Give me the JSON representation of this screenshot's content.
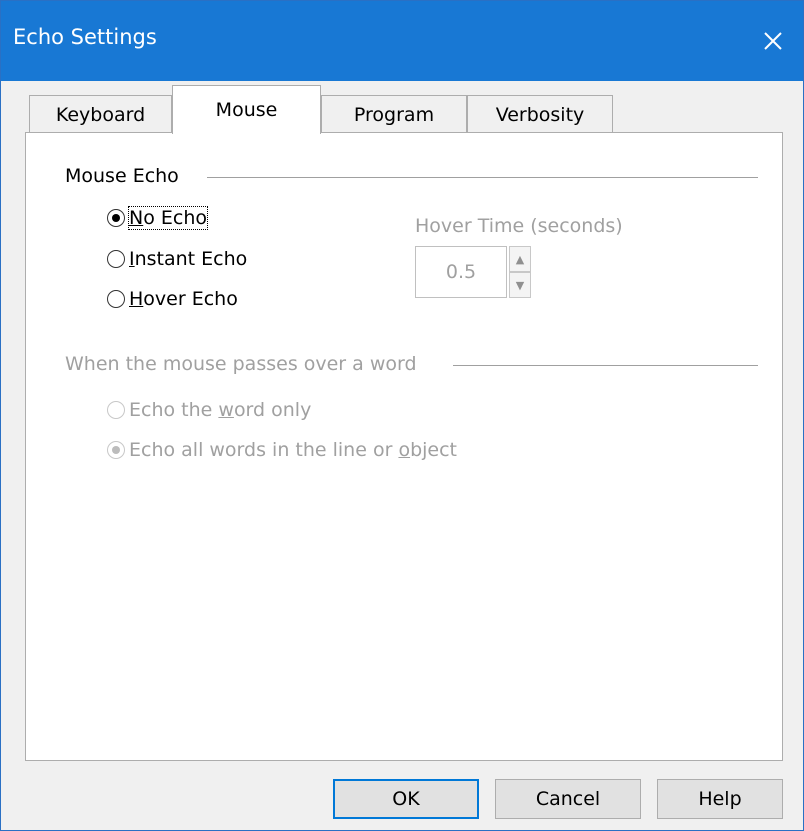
{
  "window": {
    "title": "Echo Settings"
  },
  "tabs": [
    {
      "label": "Keyboard",
      "active": false
    },
    {
      "label": "Mouse",
      "active": true
    },
    {
      "label": "Program",
      "active": false
    },
    {
      "label": "Verbosity",
      "active": false
    }
  ],
  "mouse_echo": {
    "group_label": "Mouse Echo",
    "options": [
      {
        "label_accel": "N",
        "label_rest": "o Echo",
        "checked": true
      },
      {
        "label_accel": "I",
        "label_rest": "nstant Echo",
        "checked": false
      },
      {
        "label_accel": "H",
        "label_rest": "over Echo",
        "checked": false
      }
    ],
    "hover_time_label": "Hover Time (seconds)",
    "hover_time_value": "0.5"
  },
  "word_group": {
    "group_label": "When the mouse passes over a word",
    "options": [
      {
        "pre": "Echo the ",
        "accel": "w",
        "post": "ord only",
        "checked": false
      },
      {
        "pre": "Echo all words in the line or ",
        "accel": "o",
        "post": "bject",
        "checked": true
      }
    ]
  },
  "buttons": {
    "ok": "OK",
    "cancel": "Cancel",
    "help": "Help"
  },
  "icons": {
    "close": "close-icon",
    "spin_up": "arrow-up-icon",
    "spin_down": "arrow-down-icon"
  },
  "colors": {
    "titlebar": "#1878d4",
    "default_button_border": "#0078d7"
  }
}
